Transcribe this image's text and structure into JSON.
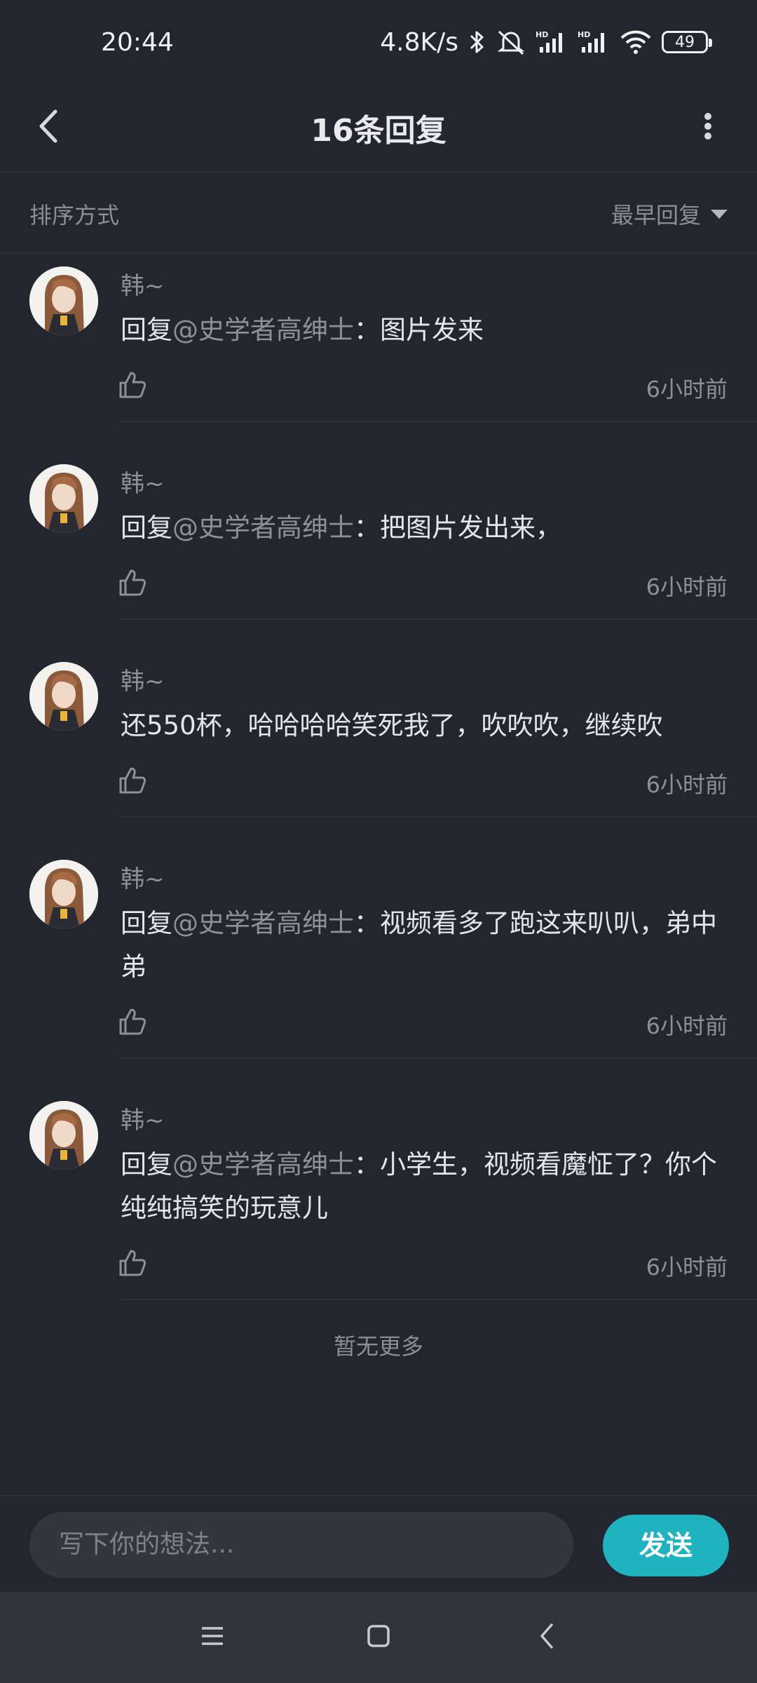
{
  "status_bar": {
    "time": "20:44",
    "network_speed": "4.8K/s",
    "battery_level": "49",
    "icons": [
      "bluetooth-icon",
      "mute-icon",
      "hd-signal-icon",
      "hd-signal-icon",
      "wifi-icon",
      "battery-icon"
    ]
  },
  "header": {
    "title": "16条回复",
    "back_icon": "chevron-left-icon",
    "more_icon": "more-vertical-icon"
  },
  "sort": {
    "label": "排序方式",
    "selected": "最早回复"
  },
  "replies": [
    {
      "username": "韩~",
      "prefix": "回复",
      "mention": "@史学者高绅士",
      "text": "：图片发来",
      "time": "6小时前"
    },
    {
      "username": "韩~",
      "prefix": "回复",
      "mention": "@史学者高绅士",
      "text": "：把图片发出来，",
      "time": "6小时前"
    },
    {
      "username": "韩~",
      "prefix": "",
      "mention": "",
      "text": "还550杯，哈哈哈哈笑死我了，吹吹吹，继续吹",
      "time": "6小时前"
    },
    {
      "username": "韩~",
      "prefix": "回复",
      "mention": "@史学者高绅士",
      "text": "：视频看多了跑这来叭叭，弟中弟",
      "time": "6小时前"
    },
    {
      "username": "韩~",
      "prefix": "回复",
      "mention": "@史学者高绅士",
      "text": "：小学生，视频看魔怔了？你个纯纯搞笑的玩意儿",
      "time": "6小时前"
    }
  ],
  "footer_note": "暂无更多",
  "composer": {
    "placeholder": "写下你的想法...",
    "send_label": "发送"
  },
  "colors": {
    "background": "#24262f",
    "accent": "#1fb3c0",
    "muted_text": "#8d8f99"
  }
}
